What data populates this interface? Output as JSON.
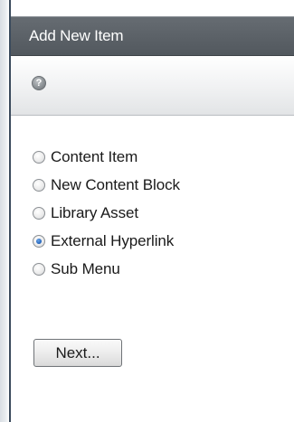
{
  "dialog": {
    "title": "Add New Item",
    "help_icon": "help-icon",
    "help_glyph": "?"
  },
  "options": [
    {
      "label": "Content Item",
      "checked": false
    },
    {
      "label": "New Content Block",
      "checked": false
    },
    {
      "label": "Library Asset",
      "checked": false
    },
    {
      "label": "External Hyperlink",
      "checked": true
    },
    {
      "label": "Sub Menu",
      "checked": false
    }
  ],
  "actions": {
    "next_label": "Next..."
  },
  "colors": {
    "titlebar": "#5c6268",
    "title_text": "#ffffff",
    "radio_selected": "#1f5fb8"
  }
}
